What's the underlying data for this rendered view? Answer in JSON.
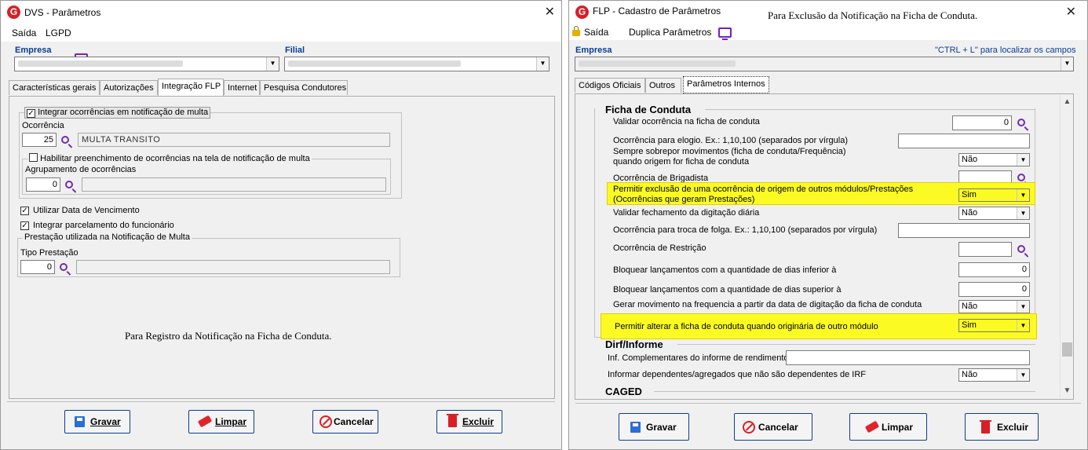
{
  "left": {
    "title": "DVS - Parâmetros",
    "menu": {
      "saida": "Saída",
      "lgpd": "LGPD"
    },
    "empresa_label": "Empresa",
    "filial_label": "Filial",
    "tabs": [
      "Características gerais",
      "Autorizações",
      "Integração FLP",
      "Internet",
      "Pesquisa Condutores"
    ],
    "integrar_multa": "Integrar ocorrências em notificação de multa",
    "ocorrencia_label": "Ocorrência",
    "ocorrencia_value": "25",
    "ocorrencia_desc": "MULTA TRANSITO",
    "habilitar": "Habilitar preenchimento de ocorrências na tela de notificação de multa",
    "agrupamento_label": "Agrupamento de ocorrências",
    "agrupamento_value": "0",
    "utilizar_data": "Utilizar Data de Vencimento",
    "integrar_parcelamento": "Integrar parcelamento do funcionário",
    "prestacao_group": "Prestação utilizada na Notificação de Multa",
    "tipo_prestacao_label": "Tipo Prestação",
    "tipo_prestacao_value": "0",
    "note": "Para Registro da Notificação na Ficha de Conduta.",
    "buttons": {
      "gravar": "Gravar",
      "limpar": "Limpar",
      "cancelar": "Cancelar",
      "excluir": "Excluir"
    }
  },
  "right": {
    "title": "FLP - Cadastro de Parâmetros",
    "note": "Para Exclusão da Notificação na Ficha de Conduta.",
    "menu": {
      "saida": "Saída",
      "duplica": "Duplica Parâmetros"
    },
    "empresa_label": "Empresa",
    "hint": "\"CTRL + L\" para localizar os campos",
    "tabs": [
      "Códigos Oficiais",
      "Outros",
      "Parâmetros Internos"
    ],
    "ficha_title": "Ficha de Conduta",
    "rows": {
      "validar": "Validar ocorrência na ficha de conduta",
      "validar_value": "0",
      "elogio": "Ocorrência para elogio. Ex.: 1,10,100 (separados por vírgula)",
      "sobrepor_1": "Sempre sobrepor movimentos (ficha de conduta/Frequência)",
      "sobrepor_2": "quando origem for ficha de conduta",
      "sobrepor_value": "Não",
      "brigadista": "Ocorrência de Brigadista",
      "permitir_excl_1": "Permitir  exclusão de uma ocorrência de origem de outros módulos/Prestações",
      "permitir_excl_2": "(Ocorrências que geram Prestações)",
      "permitir_excl_value": "Sim",
      "validar_fech": "Validar fechamento da digitação diária",
      "validar_fech_value": "Não",
      "folga": "Ocorrência para troca de folga. Ex.: 1,10,100 (separados por vírgula)",
      "restricao": "Ocorrência de Restrição",
      "bloq_inf": "Bloquear lançamentos com a quantidade de dias inferior à",
      "bloq_inf_value": "0",
      "bloq_sup": "Bloquear lançamentos com a quantidade de dias superior à",
      "bloq_sup_value": "0",
      "gerar_mov": "Gerar movimento na frequencia a partir da data de digitação da ficha de conduta",
      "gerar_mov_value": "Não",
      "permitir_alt": "Permitir alterar a ficha de conduta quando originária de outro módulo",
      "permitir_alt_value": "Sim"
    },
    "dirf_title": "Dirf/Informe",
    "inf_compl": "Inf. Complementares do informe de rendimentos",
    "inf_dep": "Informar dependentes/agregados que não são dependentes de IRF",
    "inf_dep_value": "Não",
    "caged_title": "CAGED",
    "buttons": {
      "gravar": "Gravar",
      "cancelar": "Cancelar",
      "limpar": "Limpar",
      "excluir": "Excluir"
    }
  }
}
